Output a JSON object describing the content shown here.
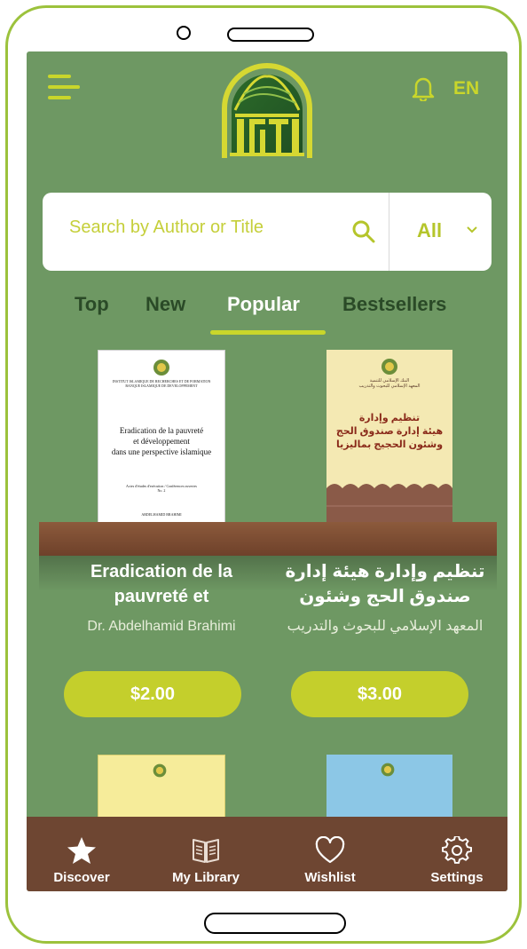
{
  "header": {
    "language": "EN"
  },
  "search": {
    "placeholder": "Search by Author or Title",
    "filter": "All"
  },
  "tabs": [
    {
      "label": "Top",
      "active": false
    },
    {
      "label": "New",
      "active": false
    },
    {
      "label": "Popular",
      "active": true
    },
    {
      "label": "Bestsellers",
      "active": false
    }
  ],
  "books": [
    {
      "title": "Eradication de la pauvreté et",
      "author": "Dr. Abdelhamid Brahimi",
      "price": "$2.00",
      "cover": {
        "header_text": "INSTITUT ISLAMIQUE DE RECHERCHES ET DE FORMATION\nBANQUE ISLAMIQUE DE DEVELOPPEMENT",
        "title": "Eradication de la pauvreté\net développement\ndans une perspective islamique",
        "series": "Actes d'études d'exécution / Conférences ouvertes\nNo. 2",
        "author": "ABDELHAMID BRAHIMI"
      }
    },
    {
      "title": "تنظيم وإدارة هيئة إدارة صندوق الحج وشئون",
      "author": "المعهد الإسلامي للبحوث والتدريب",
      "price": "$3.00",
      "cover": {
        "header_text": "البنك الإسلامي للتنمية\nالمعهد الإسلامي للبحوث والتدريب",
        "title": "تنظيم وإدارة\nهيئة إدارة صندوق الحج\nوشئون الحجيج بماليزيا"
      }
    }
  ],
  "nav": [
    {
      "label": "Discover",
      "icon": "star-icon",
      "active": true
    },
    {
      "label": "My Library",
      "icon": "book-icon",
      "active": false
    },
    {
      "label": "Wishlist",
      "icon": "heart-icon",
      "active": false
    },
    {
      "label": "Settings",
      "icon": "gear-icon",
      "active": false
    }
  ],
  "colors": {
    "screen_bg": "#6e9863",
    "accent": "#c9d62b",
    "nav_bg": "#6e4632",
    "frame": "#9cc23c"
  }
}
